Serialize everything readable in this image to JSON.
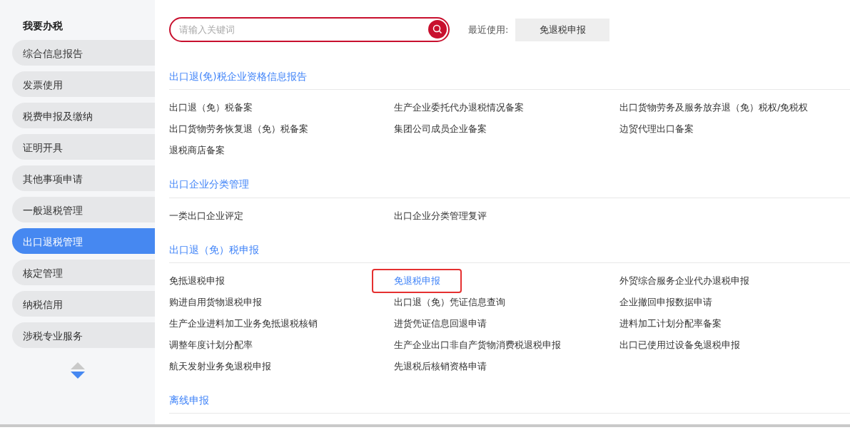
{
  "sidebar": {
    "title": "我要办税",
    "items": [
      {
        "label": "综合信息报告",
        "selected": false
      },
      {
        "label": "发票使用",
        "selected": false
      },
      {
        "label": "税费申报及缴纳",
        "selected": false
      },
      {
        "label": "证明开具",
        "selected": false
      },
      {
        "label": "其他事项申请",
        "selected": false
      },
      {
        "label": "一般退税管理",
        "selected": false
      },
      {
        "label": "出口退税管理",
        "selected": true
      },
      {
        "label": "核定管理",
        "selected": false
      },
      {
        "label": "纳税信用",
        "selected": false
      },
      {
        "label": "涉税专业服务",
        "selected": false
      }
    ]
  },
  "search": {
    "placeholder": "请输入关键词"
  },
  "recent": {
    "label": "最近使用:",
    "items": [
      "免退税申报"
    ]
  },
  "sections": [
    {
      "title": "出口退(免)税企业资格信息报告",
      "links": [
        {
          "label": "出口退（免）税备案",
          "highlighted": false
        },
        {
          "label": "生产企业委托代办退税情况备案",
          "highlighted": false
        },
        {
          "label": "出口货物劳务及服务放弃退（免）税权/免税权",
          "highlighted": false
        },
        {
          "label": "出口货物劳务恢复退（免）税备案",
          "highlighted": false
        },
        {
          "label": "集团公司成员企业备案",
          "highlighted": false
        },
        {
          "label": "边贸代理出口备案",
          "highlighted": false
        },
        {
          "label": "退税商店备案",
          "highlighted": false
        }
      ]
    },
    {
      "title": "出口企业分类管理",
      "links": [
        {
          "label": "一类出口企业评定",
          "highlighted": false
        },
        {
          "label": "出口企业分类管理复评",
          "highlighted": false
        }
      ]
    },
    {
      "title": "出口退（免）税申报",
      "links": [
        {
          "label": "免抵退税申报",
          "highlighted": false
        },
        {
          "label": "免退税申报",
          "highlighted": true
        },
        {
          "label": "外贸综合服务企业代办退税申报",
          "highlighted": false
        },
        {
          "label": "购进自用货物退税申报",
          "highlighted": false
        },
        {
          "label": "出口退（免）凭证信息查询",
          "highlighted": false
        },
        {
          "label": "企业撤回申报数据申请",
          "highlighted": false
        },
        {
          "label": "生产企业进料加工业务免抵退税核销",
          "highlighted": false
        },
        {
          "label": "进货凭证信息回退申请",
          "highlighted": false
        },
        {
          "label": "进料加工计划分配率备案",
          "highlighted": false
        },
        {
          "label": "调整年度计划分配率",
          "highlighted": false
        },
        {
          "label": "生产企业出口非自产货物消费税退税申报",
          "highlighted": false
        },
        {
          "label": "出口已使用过设备免退税申报",
          "highlighted": false
        },
        {
          "label": "航天发射业务免退税申报",
          "highlighted": false
        },
        {
          "label": "先退税后核销资格申请",
          "highlighted": false
        }
      ]
    },
    {
      "title": "离线申报"
    }
  ]
}
